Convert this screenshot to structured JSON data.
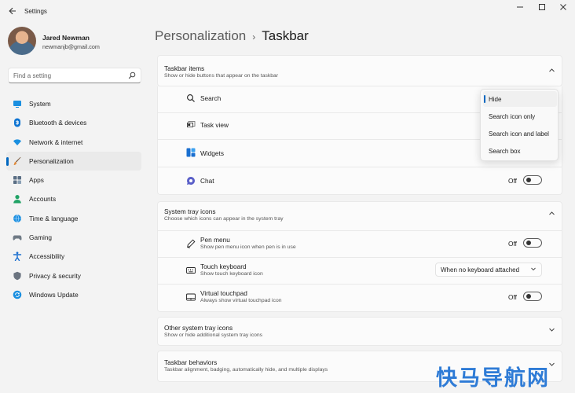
{
  "window": {
    "title": "Settings",
    "controls": [
      "minimize",
      "maximize",
      "close"
    ]
  },
  "user": {
    "name": "Jared Newman",
    "email": "newmanjb@gmail.com"
  },
  "search": {
    "placeholder": "Find a setting",
    "icon": "search-icon"
  },
  "sidebar": {
    "items": [
      {
        "label": "System",
        "icon": "system-icon",
        "color": "#1a8fe0"
      },
      {
        "label": "Bluetooth & devices",
        "icon": "bluetooth-icon",
        "color": "#0e74d2"
      },
      {
        "label": "Network & internet",
        "icon": "wifi-icon",
        "color": "#1a8fe0"
      },
      {
        "label": "Personalization",
        "icon": "brush-icon",
        "color": "#e08a3a",
        "active": true
      },
      {
        "label": "Apps",
        "icon": "apps-icon",
        "color": "#5b6f85"
      },
      {
        "label": "Accounts",
        "icon": "person-icon",
        "color": "#21a366"
      },
      {
        "label": "Time & language",
        "icon": "globe-clock-icon",
        "color": "#1a8fe0"
      },
      {
        "label": "Gaming",
        "icon": "controller-icon",
        "color": "#6f7a85"
      },
      {
        "label": "Accessibility",
        "icon": "accessibility-icon",
        "color": "#1a6fd0"
      },
      {
        "label": "Privacy & security",
        "icon": "shield-icon",
        "color": "#6b7480"
      },
      {
        "label": "Windows Update",
        "icon": "update-icon",
        "color": "#1a8fe0"
      }
    ]
  },
  "breadcrumb": {
    "parent": "Personalization",
    "separator": "›",
    "current": "Taskbar"
  },
  "taskbar_items": {
    "title": "Taskbar items",
    "subtitle": "Show or hide buttons that appear on the taskbar",
    "rows": [
      {
        "label": "Search",
        "icon": "search-icon"
      },
      {
        "label": "Task view",
        "icon": "taskview-icon"
      },
      {
        "label": "Widgets",
        "icon": "widgets-icon"
      },
      {
        "label": "Chat",
        "icon": "chat-icon",
        "toggle_text": "Off"
      }
    ]
  },
  "search_menu": {
    "options": [
      "Hide",
      "Search icon only",
      "Search icon and label",
      "Search box"
    ],
    "selected": "Hide"
  },
  "system_tray": {
    "title": "System tray icons",
    "subtitle": "Choose which icons can appear in the system tray",
    "rows": [
      {
        "label": "Pen menu",
        "sub": "Show pen menu icon when pen is in use",
        "icon": "pen-icon",
        "toggle_text": "Off"
      },
      {
        "label": "Touch keyboard",
        "sub": "Show touch keyboard icon",
        "icon": "keyboard-icon",
        "dropdown": "When no keyboard attached"
      },
      {
        "label": "Virtual touchpad",
        "sub": "Always show virtual touchpad icon",
        "icon": "touchpad-icon",
        "toggle_text": "Off"
      }
    ]
  },
  "other_tray": {
    "title": "Other system tray icons",
    "subtitle": "Show or hide additional system tray icons"
  },
  "behaviors": {
    "title": "Taskbar behaviors",
    "subtitle": "Taskbar alignment, badging, automatically hide, and multiple displays"
  },
  "watermark": "快马导航网"
}
